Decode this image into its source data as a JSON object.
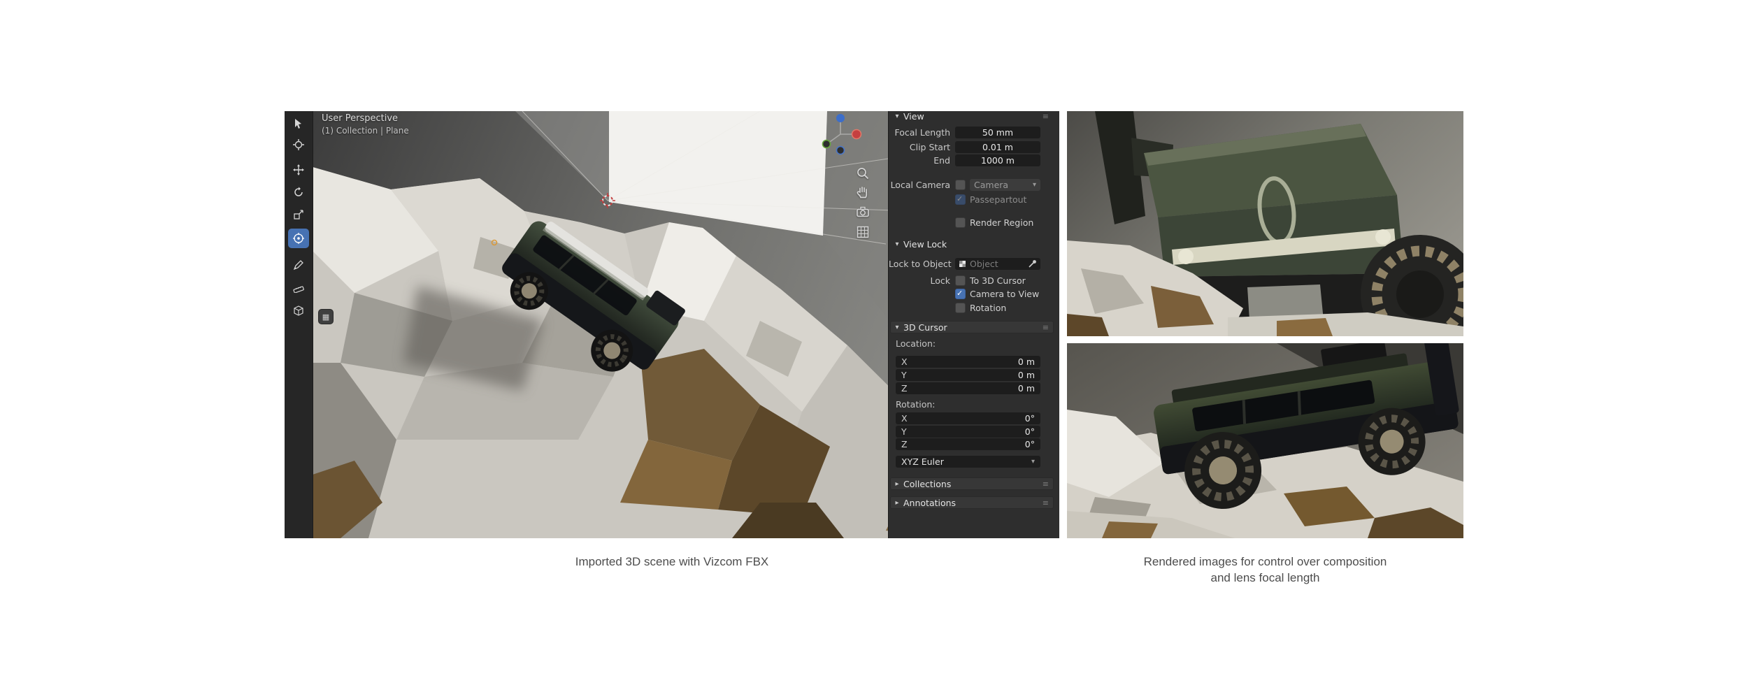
{
  "page": {
    "background": "#ffffff",
    "caption_left": "Imported 3D scene with Vizcom FBX",
    "caption_right_line1": "Rendered images for control over composition",
    "caption_right_line2": "and lens focal length"
  },
  "viewport": {
    "overlay_line1": "User Perspective",
    "overlay_line2": "(1) Collection | Plane"
  },
  "icons": {
    "chevron_down": "▾",
    "chevron_right": "▸",
    "menu": "≡",
    "caret_down": "▾",
    "check": "✓",
    "expand": "▦"
  },
  "toolbar_tools": [
    {
      "name": "select-box"
    },
    {
      "name": "cursor"
    },
    {
      "name": "move"
    },
    {
      "name": "rotate"
    },
    {
      "name": "scale"
    },
    {
      "name": "transform",
      "active": true
    },
    {
      "name": "annotate"
    },
    {
      "name": "measure"
    },
    {
      "name": "add-cube"
    }
  ],
  "panel": {
    "header_view": "View",
    "focal_length": {
      "label": "Focal Length",
      "value": "50 mm"
    },
    "clip_start": {
      "label": "Clip Start",
      "value": "0.01 m"
    },
    "clip_end": {
      "label": "End",
      "value": "1000 m"
    },
    "local_camera": {
      "label": "Local Camera",
      "value": "Camera"
    },
    "passepartout": {
      "label": "Passepartout",
      "checked": true,
      "disabled": true
    },
    "render_region": {
      "label": "Render Region",
      "checked": false
    },
    "view_lock": {
      "header": "View Lock",
      "lock_to_object": {
        "label": "Lock to Object",
        "placeholder": "Object"
      },
      "lock_label": "Lock",
      "to_3d_cursor": {
        "label": "To 3D Cursor",
        "checked": false
      },
      "camera_to_view": {
        "label": "Camera to View",
        "checked": true
      },
      "rotation": {
        "label": "Rotation",
        "checked": false
      }
    },
    "cursor_3d": {
      "header": "3D Cursor",
      "location_label": "Location:",
      "location": [
        {
          "axis": "X",
          "value": "0 m"
        },
        {
          "axis": "Y",
          "value": "0 m"
        },
        {
          "axis": "Z",
          "value": "0 m"
        }
      ],
      "rotation_label": "Rotation:",
      "rotation": [
        {
          "axis": "X",
          "value": "0°"
        },
        {
          "axis": "Y",
          "value": "0°"
        },
        {
          "axis": "Z",
          "value": "0°"
        }
      ],
      "euler": "XYZ Euler"
    },
    "collections_header": "Collections",
    "annotations_header": "Annotations"
  },
  "colors": {
    "accent_blue": "#4772b3",
    "panel_bg": "#2e2e2e",
    "field_bg": "#1d1d1d",
    "axis_x_red": "#c54040",
    "axis_z_blue": "#3d6ec9",
    "axis_y_green": "#67a83c",
    "truck_green": "#3e4839",
    "caption_gray": "#4c4c4c"
  }
}
